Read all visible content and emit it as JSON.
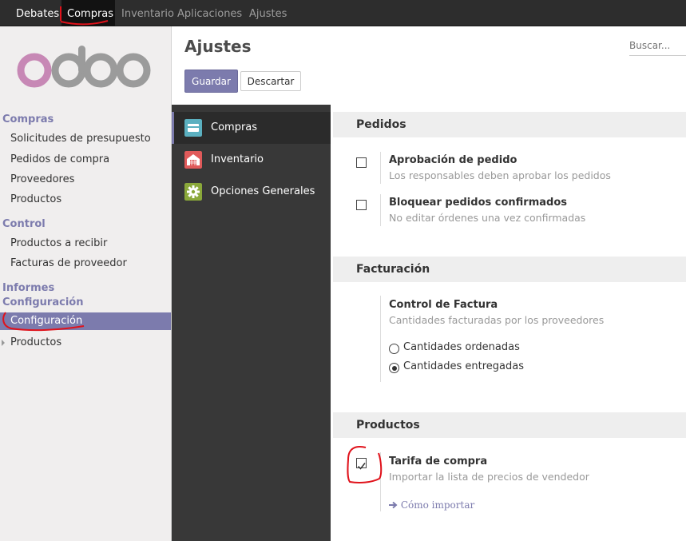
{
  "topbar": {
    "items": [
      "Debates",
      "Compras",
      "Inventario",
      "Aplicaciones",
      "Ajustes"
    ]
  },
  "sidebar": {
    "logo_text": "odoo",
    "sections": [
      {
        "heading": "Compras",
        "items": [
          "Solicitudes de presupuesto",
          "Pedidos de compra",
          "Proveedores",
          "Productos"
        ]
      },
      {
        "heading": "Control",
        "items": [
          "Productos a recibir",
          "Facturas de proveedor"
        ]
      },
      {
        "heading": "Informes"
      },
      {
        "heading": "Configuración",
        "items": [
          "Configuración",
          "Productos"
        ]
      }
    ]
  },
  "control": {
    "title": "Ajustes",
    "search_placeholder": "Buscar...",
    "save_label": "Guardar",
    "discard_label": "Descartar"
  },
  "apps": [
    {
      "label": "Compras",
      "icon": "purchase-icon",
      "color": "#5bb0c0"
    },
    {
      "label": "Inventario",
      "icon": "inventory-icon",
      "color": "#e05a5a"
    },
    {
      "label": "Opciones Generales",
      "icon": "gear-icon",
      "color": "#8aa83a"
    }
  ],
  "settings": {
    "pedidos": {
      "heading": "Pedidos",
      "approval_title": "Aprobación de pedido",
      "approval_desc": "Los responsables deben aprobar los pedidos",
      "lock_title": "Bloquear pedidos confirmados",
      "lock_desc": "No editar órdenes una vez confirmadas"
    },
    "facturacion": {
      "heading": "Facturación",
      "control_title": "Control de Factura",
      "control_desc": "Cantidades facturadas por los proveedores",
      "opt_ordered": "Cantidades ordenadas",
      "opt_delivered": "Cantidades entregadas"
    },
    "productos": {
      "heading": "Productos",
      "tariff_title": "Tarifa de compra",
      "tariff_desc": "Importar la lista de precios de vendedor",
      "import_link": "Cómo importar"
    }
  },
  "colors": {
    "accent": "#7c7bad",
    "annotation": "#e0121b"
  }
}
